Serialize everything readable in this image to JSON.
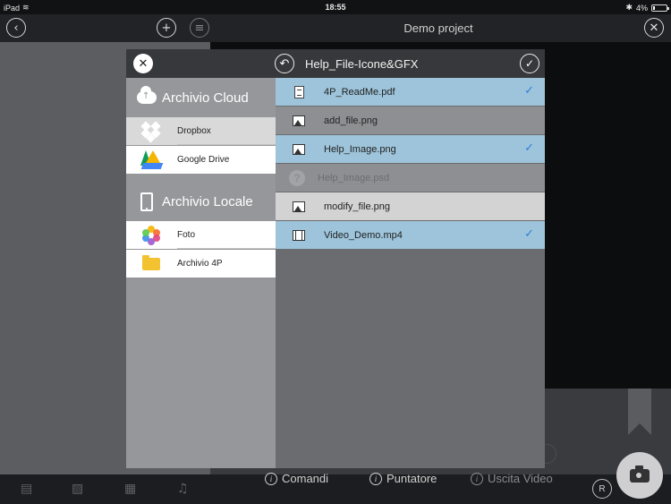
{
  "status_bar": {
    "device": "iPad",
    "time": "18:55",
    "battery": "4%"
  },
  "app_bar": {
    "title": "Demo project"
  },
  "modal": {
    "title": "Help_File-Icone&GFX",
    "sections": [
      {
        "label": "Archivio Cloud",
        "icon": "cloud-icon",
        "items": [
          {
            "label": "Dropbox",
            "icon": "dropbox-icon"
          },
          {
            "label": "Google Drive",
            "icon": "google-drive-icon"
          }
        ]
      },
      {
        "label": "Archivio Locale",
        "icon": "tablet-icon",
        "items": [
          {
            "label": "Foto",
            "icon": "photos-icon"
          },
          {
            "label": "Archivio 4P",
            "icon": "folder-icon"
          }
        ]
      }
    ],
    "files": [
      {
        "name": "4P_ReadMe.pdf",
        "icon": "document-icon",
        "selected": true
      },
      {
        "name": "add_file.png",
        "icon": "image-icon",
        "selected": false
      },
      {
        "name": "Help_Image.png",
        "icon": "image-icon",
        "selected": true
      },
      {
        "name": "Help_Image.psd",
        "icon": "unknown-file-icon",
        "selected": false
      },
      {
        "name": "modify_file.png",
        "icon": "image-icon",
        "selected": false
      },
      {
        "name": "Video_Demo.mp4",
        "icon": "video-icon",
        "selected": true
      }
    ],
    "checkmark": "✓"
  },
  "toolbar": {
    "comandi": "Comandi",
    "puntatore": "Puntatore",
    "uscita_video": "Uscita Video",
    "r_label": "R"
  },
  "colors": {
    "selected_row": "#9dc4da",
    "check": "#2e7fd8"
  }
}
